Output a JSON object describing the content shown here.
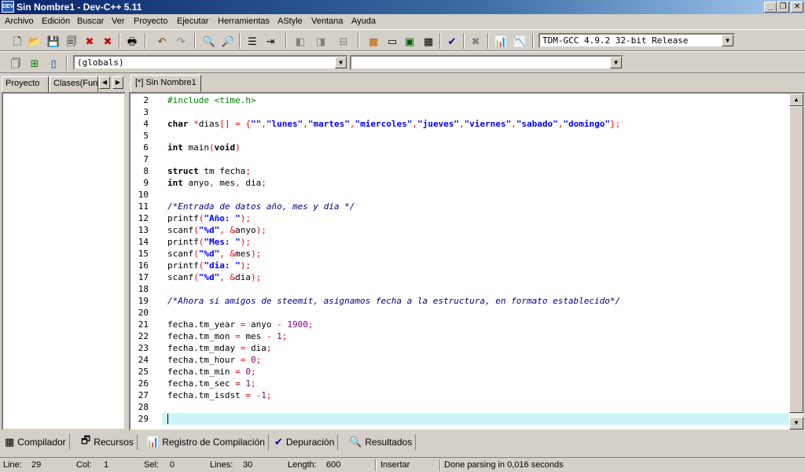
{
  "window": {
    "title": "Sin Nombre1 - Dev-C++ 5.11",
    "icon": "devcpp-logo"
  },
  "menu": [
    "Archivo",
    "Edición",
    "Buscar",
    "Ver",
    "Proyecto",
    "Ejecutar",
    "Herramientas",
    "AStyle",
    "Ventana",
    "Ayuda"
  ],
  "toolbar": {
    "compiler": "TDM-GCC 4.9.2 32-bit Release"
  },
  "scope": {
    "class_combo": "(globals)",
    "function_combo": ""
  },
  "left_panel": {
    "tabs": [
      "Proyecto",
      "Clases(Fun"
    ]
  },
  "editor": {
    "tab": "[*] Sin Nombre1",
    "line_numbers": [
      "2",
      "3",
      "4",
      "5",
      "6",
      "7",
      "8",
      "9",
      "10",
      "11",
      "12",
      "13",
      "14",
      "15",
      "16",
      "17",
      "18",
      "19",
      "20",
      "21",
      "22",
      "23",
      "24",
      "25",
      "26",
      "27",
      "28",
      "29"
    ],
    "lines": [
      "#include <time.h>",
      "",
      "char *dias[] = {\"\",\"lunes\",\"martes\",\"miercoles\",\"jueves\",\"viernes\",\"sabado\",\"domingo\"};",
      "",
      "int main(void)",
      "",
      "struct tm fecha;",
      "int anyo, mes, dia;",
      "",
      "/*Entrada de datos año, mes y día */",
      "printf(\"Año: \");",
      "scanf(\"%d\", &anyo);",
      "printf(\"Mes: \");",
      "scanf(\"%d\", &mes);",
      "printf(\"dia: \");",
      "scanf(\"%d\", &dia);",
      "",
      "/*Ahora si amigos de steemit, asignamos fecha a la estructura, en formato establecido*/",
      "",
      "fecha.tm_year = anyo - 1900;",
      "fecha.tm_mon = mes - 1;",
      "fecha.tm_mday = dia;",
      "fecha.tm_hour = 0;",
      "fecha.tm_min = 0;",
      "fecha.tm_sec = 1;",
      "fecha.tm_isdst = -1;",
      "",
      ""
    ]
  },
  "bottom_tabs": [
    "Compilador",
    "Recursos",
    "Registro de Compilación",
    "Depuración",
    "Resultados"
  ],
  "status": {
    "line_label": "Line:",
    "line": "29",
    "col_label": "Col:",
    "col": "1",
    "sel_label": "Sel:",
    "sel": "0",
    "lines_label": "Lines:",
    "lines": "30",
    "length_label": "Length:",
    "length": "600",
    "mode": "Insertar",
    "message": "Done parsing in 0,016 seconds"
  }
}
